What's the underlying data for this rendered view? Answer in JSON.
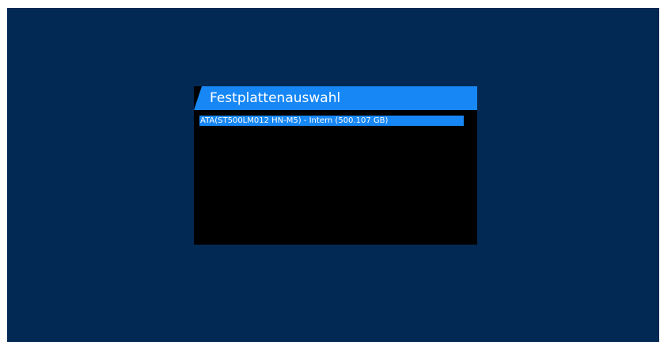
{
  "dialog": {
    "title": "Festplattenauswahl"
  },
  "disks": [
    {
      "label": "ATA(ST500LM012 HN-M5) - Intern (500.107 GB)",
      "selected": true
    }
  ],
  "colors": {
    "background": "#022954",
    "dialog_background": "#000000",
    "accent": "#1787f5",
    "text": "#ffffff"
  }
}
